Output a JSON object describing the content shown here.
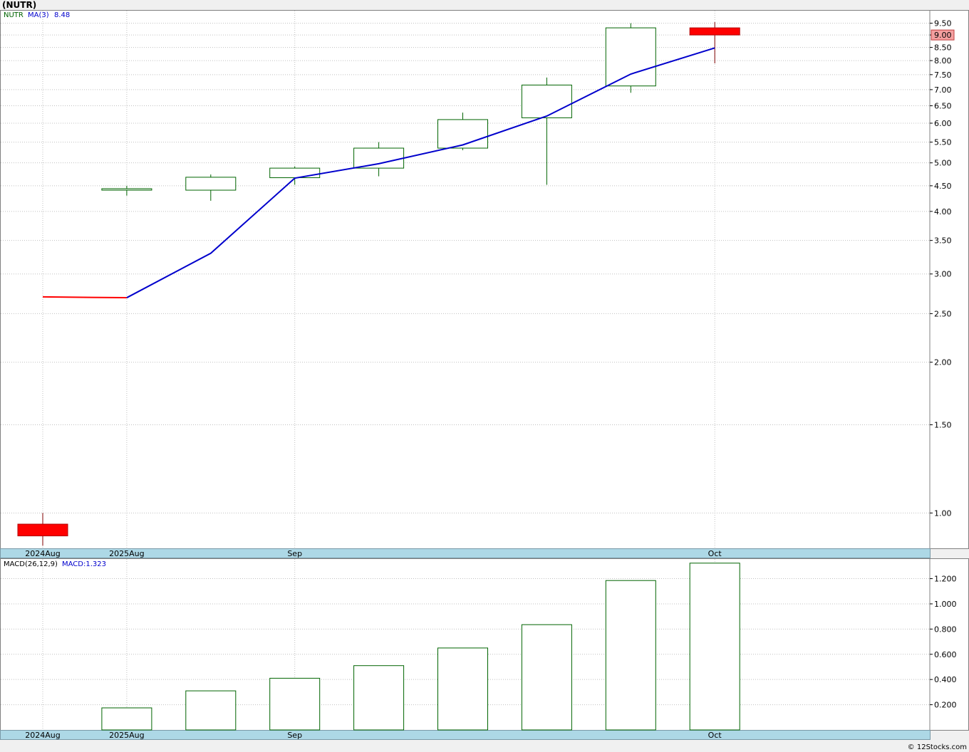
{
  "title": "(NUTR)",
  "credit": "© 12Stocks.com",
  "colors": {
    "up": "#006400",
    "down": "#ff0000",
    "ma": "#0000cc",
    "ma_start": "#ff0000",
    "grid": "#c0c0c0",
    "strip": "#add8e6"
  },
  "legend": {
    "symbol": "NUTR",
    "ma_label": "MA(3)",
    "ma_value": "8.48",
    "macd_label": "MACD(26,12,9)",
    "macd_value_label": "MACD:1.323"
  },
  "last_price_label": "9.00",
  "chart_data": [
    {
      "type": "candlestick",
      "scale": "log",
      "ylim": [
        0.85,
        9.9
      ],
      "x_labels": [
        "2024Aug",
        "2025Aug",
        "Sep",
        "Oct"
      ],
      "y_ticks": [
        "9.50",
        "9.00",
        "8.50",
        "8.00",
        "7.50",
        "7.00",
        "6.50",
        "6.00",
        "5.50",
        "5.00",
        "4.50",
        "4.00",
        "3.50",
        "3.00",
        "2.50",
        "2.00",
        "1.50",
        "1.00"
      ],
      "candles": [
        {
          "label": "2024Aug",
          "open": 0.95,
          "high": 1.0,
          "low": 0.86,
          "close": 0.9
        },
        {
          "label": "2025Aug",
          "open": 4.41,
          "high": 4.5,
          "low": 4.3,
          "close": 4.44
        },
        {
          "label": "",
          "open": 4.41,
          "high": 4.74,
          "low": 4.2,
          "close": 4.68
        },
        {
          "label": "Sep",
          "open": 4.67,
          "high": 4.92,
          "low": 4.52,
          "close": 4.88
        },
        {
          "label": "",
          "open": 4.88,
          "high": 5.5,
          "low": 4.7,
          "close": 5.35
        },
        {
          "label": "",
          "open": 5.35,
          "high": 6.3,
          "low": 5.3,
          "close": 6.1
        },
        {
          "label": "",
          "open": 6.15,
          "high": 7.4,
          "low": 4.52,
          "close": 7.15
        },
        {
          "label": "",
          "open": 7.12,
          "high": 9.5,
          "low": 6.9,
          "close": 9.3
        },
        {
          "label": "Oct",
          "open": 9.3,
          "high": 9.55,
          "low": 7.9,
          "close": 9.0
        }
      ],
      "ma": [
        2.7,
        2.69,
        3.3,
        4.66,
        4.98,
        5.43,
        6.2,
        7.52,
        8.48
      ]
    },
    {
      "type": "bar",
      "title": "MACD(26,12,9)",
      "ylim": [
        0,
        1.35
      ],
      "y_ticks": [
        "1.200",
        "1.000",
        "0.800",
        "0.600",
        "0.400",
        "0.200"
      ],
      "values": [
        0,
        0.175,
        0.31,
        0.41,
        0.51,
        0.65,
        0.835,
        1.185,
        1.323
      ]
    }
  ]
}
